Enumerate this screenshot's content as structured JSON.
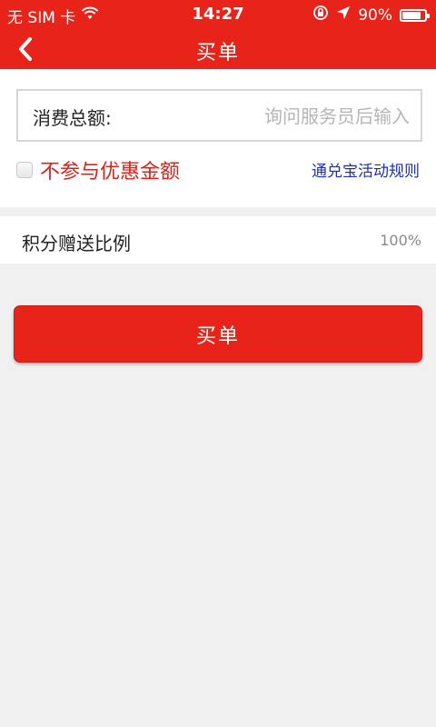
{
  "status_bar": {
    "carrier": "无 SIM 卡",
    "time": "14:27",
    "battery_text": "90%",
    "battery_level": 0.9,
    "icons": [
      "wifi-icon",
      "rotation-lock-icon",
      "location-arrow-icon",
      "battery-icon"
    ]
  },
  "nav": {
    "title": "买单",
    "back_icon": "chevron-left-icon"
  },
  "form": {
    "amount_label": "消费总额:",
    "amount_placeholder": "询问服务员后输入",
    "amount_value": "",
    "exclude_discount_label": "不参与优惠金额",
    "exclude_discount_checked": false,
    "rules_link": "通兑宝活动规则"
  },
  "points": {
    "label": "积分赠送比例",
    "value": "100%"
  },
  "pay_button": {
    "label": "买单"
  },
  "colors": {
    "brand_red": "#e8231a",
    "link_blue": "#1d2fb5",
    "warning_red": "#d8231b",
    "background": "#f0f0f0"
  }
}
